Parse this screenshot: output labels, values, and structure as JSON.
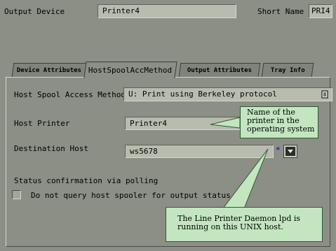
{
  "header": {
    "output_device_label": "Output Device",
    "output_device_value": "Printer4",
    "short_name_label": "Short Name",
    "short_name_value": "PRI4"
  },
  "tabs": [
    {
      "label": "Device Attributes"
    },
    {
      "label": "HostSpoolAccMethod",
      "active": true
    },
    {
      "label": "Output Attributes"
    },
    {
      "label": "Tray Info"
    }
  ],
  "form": {
    "access_method_label": "Host Spool Access Method",
    "access_method_value": "U: Print using Berkeley protocol",
    "host_printer_label": "Host Printer",
    "host_printer_value": "Printer4",
    "destination_host_label": "Destination Host",
    "destination_host_value": "ws5678",
    "required_marker": "*",
    "status_heading": "Status confirmation via polling",
    "no_query_label": "Do not query host spooler for output status",
    "no_query_checked": false
  },
  "callouts": {
    "host_printer_note": "Name of the printer in the operating system",
    "destination_host_note": "The Line Printer Daemon lpd is running on this UNIX host."
  },
  "colors": {
    "background": "#8b8f86",
    "field": "#b8bcae",
    "callout": "#c3e6c0"
  }
}
